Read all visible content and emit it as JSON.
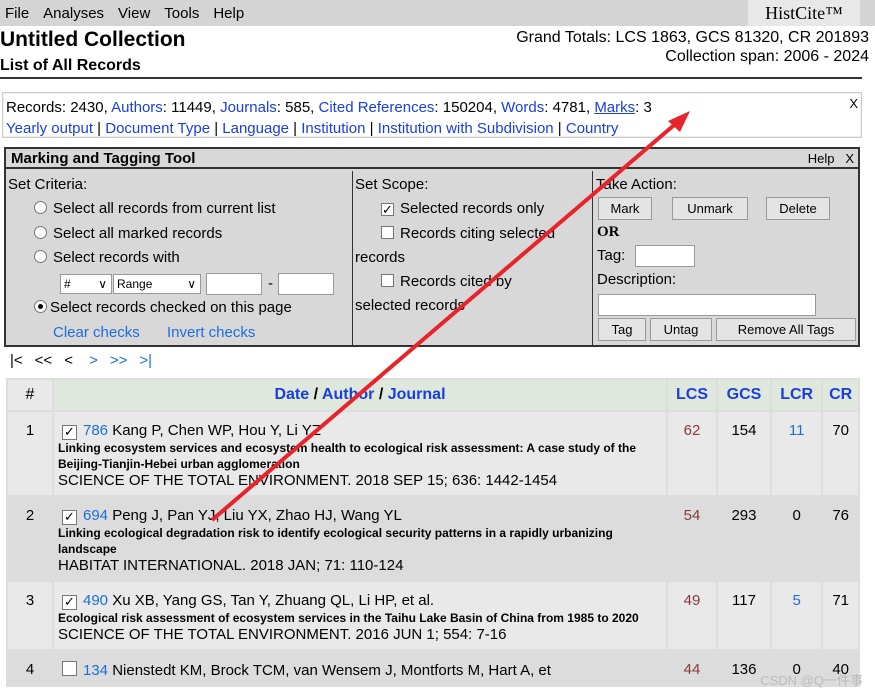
{
  "menu": [
    "File",
    "Analyses",
    "View",
    "Tools",
    "Help"
  ],
  "brand": "HistCite™",
  "title": "Untitled Collection",
  "subtitle": "List of All Records",
  "totals": {
    "line1": "Grand Totals: LCS 1863, GCS 81320, CR 201893",
    "line2": "Collection span: 2006 - 2024"
  },
  "info": {
    "records_label": "Records",
    "records": "2430",
    "authors_label": "Authors",
    "authors": "11449",
    "journals_label": "Journals",
    "journals": "585",
    "cited_label": "Cited References",
    "cited": "150204",
    "words_label": "Words",
    "words": "4781",
    "marks_label": "Marks",
    "marks": "3",
    "close": "X",
    "links": [
      "Yearly output",
      "Document Type",
      "Language",
      "Institution",
      "Institution with Subdivision",
      "Country"
    ]
  },
  "tool": {
    "title": "Marking and Tagging Tool",
    "help": "Help",
    "close": "X",
    "criteria_label": "Set Criteria:",
    "c_all": "Select all records from current list",
    "c_marked": "Select all marked records",
    "c_with": "Select records with",
    "field_select": "#",
    "range_select": "Range",
    "dash": "-",
    "c_checked": "Select records checked on this page",
    "clear": "Clear checks",
    "invert": "Invert checks",
    "scope_label": "Set Scope:",
    "s_selected": "Selected records only",
    "s_citing_a": "Records citing selected",
    "s_citing_b": "records",
    "s_cited_a": "Records cited by",
    "s_cited_b": "selected records",
    "action_label": "Take Action:",
    "mark": "Mark",
    "unmark": "Unmark",
    "delete": "Delete",
    "or": "OR",
    "tag_label": "Tag:",
    "desc_label": "Description:",
    "tag": "Tag",
    "untag": "Untag",
    "remove": "Remove All Tags"
  },
  "nav": [
    "|<",
    "<<",
    "<",
    ">",
    ">>",
    ">|"
  ],
  "table": {
    "headers": {
      "num": "#",
      "date": "Date",
      "author": "Author",
      "journal": "Journal",
      "sep": "/",
      "lcs": "LCS",
      "gcs": "GCS",
      "lcr": "LCR",
      "cr": "CR"
    },
    "rows": [
      {
        "n": "1",
        "checked": true,
        "id": "786",
        "authors": "Kang P, Chen WP, Hou Y, Li YZ",
        "title": "Linking ecosystem services and ecosystem health to ecological risk assessment: A case study of the Beijing-Tianjin-Hebei urban agglomeration",
        "source": "SCIENCE OF THE TOTAL ENVIRONMENT. 2018 SEP 15; 636: 1442-1454",
        "lcs": "62",
        "gcs": "154",
        "lcr": "11",
        "cr": "70"
      },
      {
        "n": "2",
        "checked": true,
        "id": "694",
        "authors": "Peng J, Pan YJ, Liu YX, Zhao HJ, Wang YL",
        "title": "Linking ecological degradation risk to identify ecological security patterns in a rapidly urbanizing landscape",
        "source": "HABITAT INTERNATIONAL. 2018 JAN; 71: 110-124",
        "lcs": "54",
        "gcs": "293",
        "lcr": "0",
        "cr": "76"
      },
      {
        "n": "3",
        "checked": true,
        "id": "490",
        "authors": "Xu XB, Yang GS, Tan Y, Zhuang QL, Li HP, et al.",
        "title": "Ecological risk assessment of ecosystem services in the Taihu Lake Basin of China from 1985 to 2020",
        "source": "SCIENCE OF THE TOTAL ENVIRONMENT. 2016 JUN 1; 554: 7-16",
        "lcs": "49",
        "gcs": "117",
        "lcr": "5",
        "cr": "71"
      },
      {
        "n": "4",
        "checked": false,
        "id": "134",
        "authors": "Nienstedt KM, Brock TCM, van Wensem J, Montforts M, Hart A, et",
        "title": "",
        "source": "",
        "lcs": "44",
        "gcs": "136",
        "lcr": "0",
        "cr": "40"
      }
    ]
  },
  "watermark": "CSDN @Q一件事",
  "colors": {
    "link": "#1a3ee0",
    "lcs": "#8b3a3a",
    "annotation_arrow": "#e8232a"
  }
}
